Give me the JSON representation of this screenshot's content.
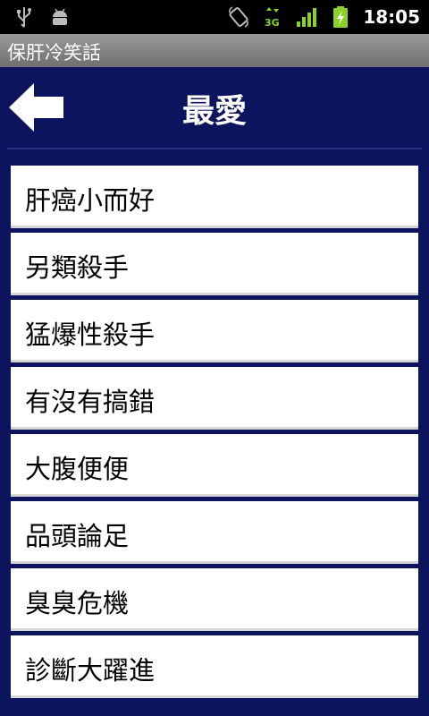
{
  "status_bar": {
    "left_icons": [
      "usb-icon",
      "android-debug-icon"
    ],
    "right_icons": [
      "rotate-icon",
      "3g-icon",
      "signal-icon",
      "battery-charging-icon"
    ],
    "network_label": "3G",
    "time": "18:05"
  },
  "app": {
    "title": "保肝冷笑話"
  },
  "header": {
    "title": "最愛"
  },
  "list": {
    "items": [
      "肝癌小而好",
      "另類殺手",
      "猛爆性殺手",
      "有沒有搞錯",
      "大腹便便",
      "品頭論足",
      "臭臭危機",
      "診斷大躍進"
    ]
  },
  "colors": {
    "background": "#0b145c",
    "list_item": "#ffffff",
    "titlebar": "#8a8a8a"
  }
}
